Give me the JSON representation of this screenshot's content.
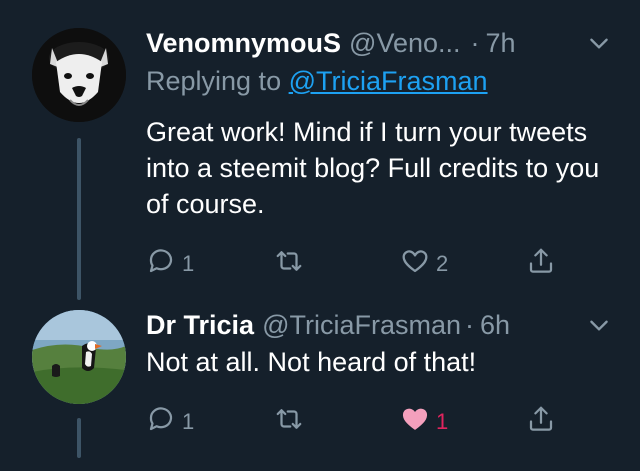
{
  "tweets": [
    {
      "display_name": "VenomnymouS",
      "handle": "@Veno...",
      "dot": "·",
      "time": "7h",
      "replying_prefix": "Replying to",
      "replying_to": "@TriciaFrasman",
      "text": "Great work! Mind if I turn your tweets into a steemit blog? Full credits to you of course.",
      "reply_count": "1",
      "retweet_count": "",
      "like_count": "2",
      "liked": false
    },
    {
      "display_name": "Dr Tricia",
      "handle": "@TriciaFrasman",
      "dot": "·",
      "time": "6h",
      "text": "Not at all. Not heard of that!",
      "reply_count": "1",
      "retweet_count": "",
      "like_count": "1",
      "liked": true
    }
  ],
  "colors": {
    "background": "#15202b",
    "secondary_text": "#8899a6",
    "link": "#1da1f2",
    "like": "#e0245e",
    "thread_line": "#3d5466"
  },
  "icons": [
    "reply-icon",
    "retweet-icon",
    "like-icon",
    "share-icon",
    "chevron-down-icon"
  ]
}
